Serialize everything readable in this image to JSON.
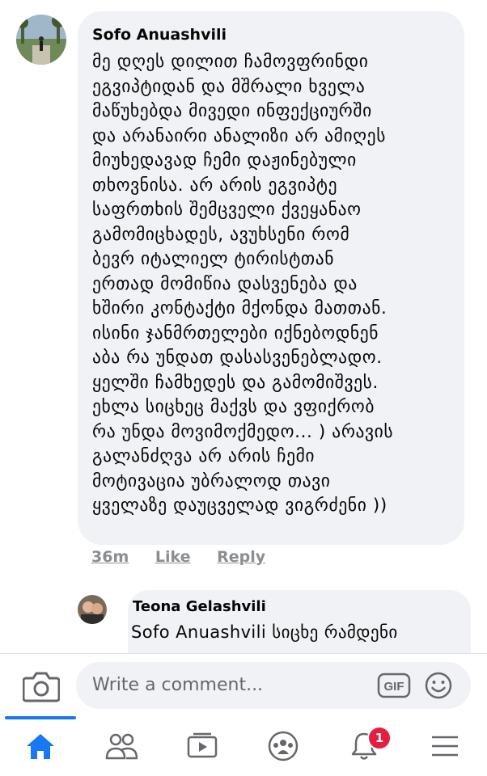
{
  "comment": {
    "author": "Sofo Anuashvili",
    "lines": [
      "მე დღეს დილით ჩამოვფრინდი",
      "ეგვიპტიდან და მშრალი ხველა",
      "მაწუხებდა მივედი ინფექციურში",
      "და არანაირი ანალიზი არ ამიღეს",
      "მიუხედავად ჩემი დაჟინებული",
      "თხოვნისა. არ არის ეგვიპტე",
      "საფრთხის შემცველი ქვეყანაო",
      "გამომიცხადეს, ავუხსენი რომ",
      "ბევრ იტალიელ ტირისტთან",
      "ერთად მომიწია დასვენება და",
      "ხშირი კონტაქტი მქონდა მათთან.",
      "ისინი ჯანმრთელები იქნებოდნენ",
      "აბა რა უნდათ დასასვენებლადო.",
      "ყელში ჩამხედეს და გამომიშვეს.",
      "ეხლა სიცხეც მაქვს და ვფიქრობ",
      "რა უნდა მოვიმოქმედო... ) არავის",
      "გალანძღვა არ არის ჩემი",
      "მოტივაცია უბრალოდ თავი",
      "ყველაზე დაუცველად ვიგრძენი ))"
    ],
    "time": "36m",
    "like_label": "Like",
    "reply_label": "Reply"
  },
  "reply": {
    "author": "Teona Gelashvili",
    "text": "Sofo Anuashvili სიცხე რამდენი"
  },
  "composer": {
    "placeholder": "Write a comment...",
    "gif_label": "GIF"
  },
  "nav": {
    "notifications_count": "1"
  },
  "colors": {
    "accent": "#1877f2",
    "badge": "#e41e3f",
    "bubble": "#f0f2f5"
  }
}
